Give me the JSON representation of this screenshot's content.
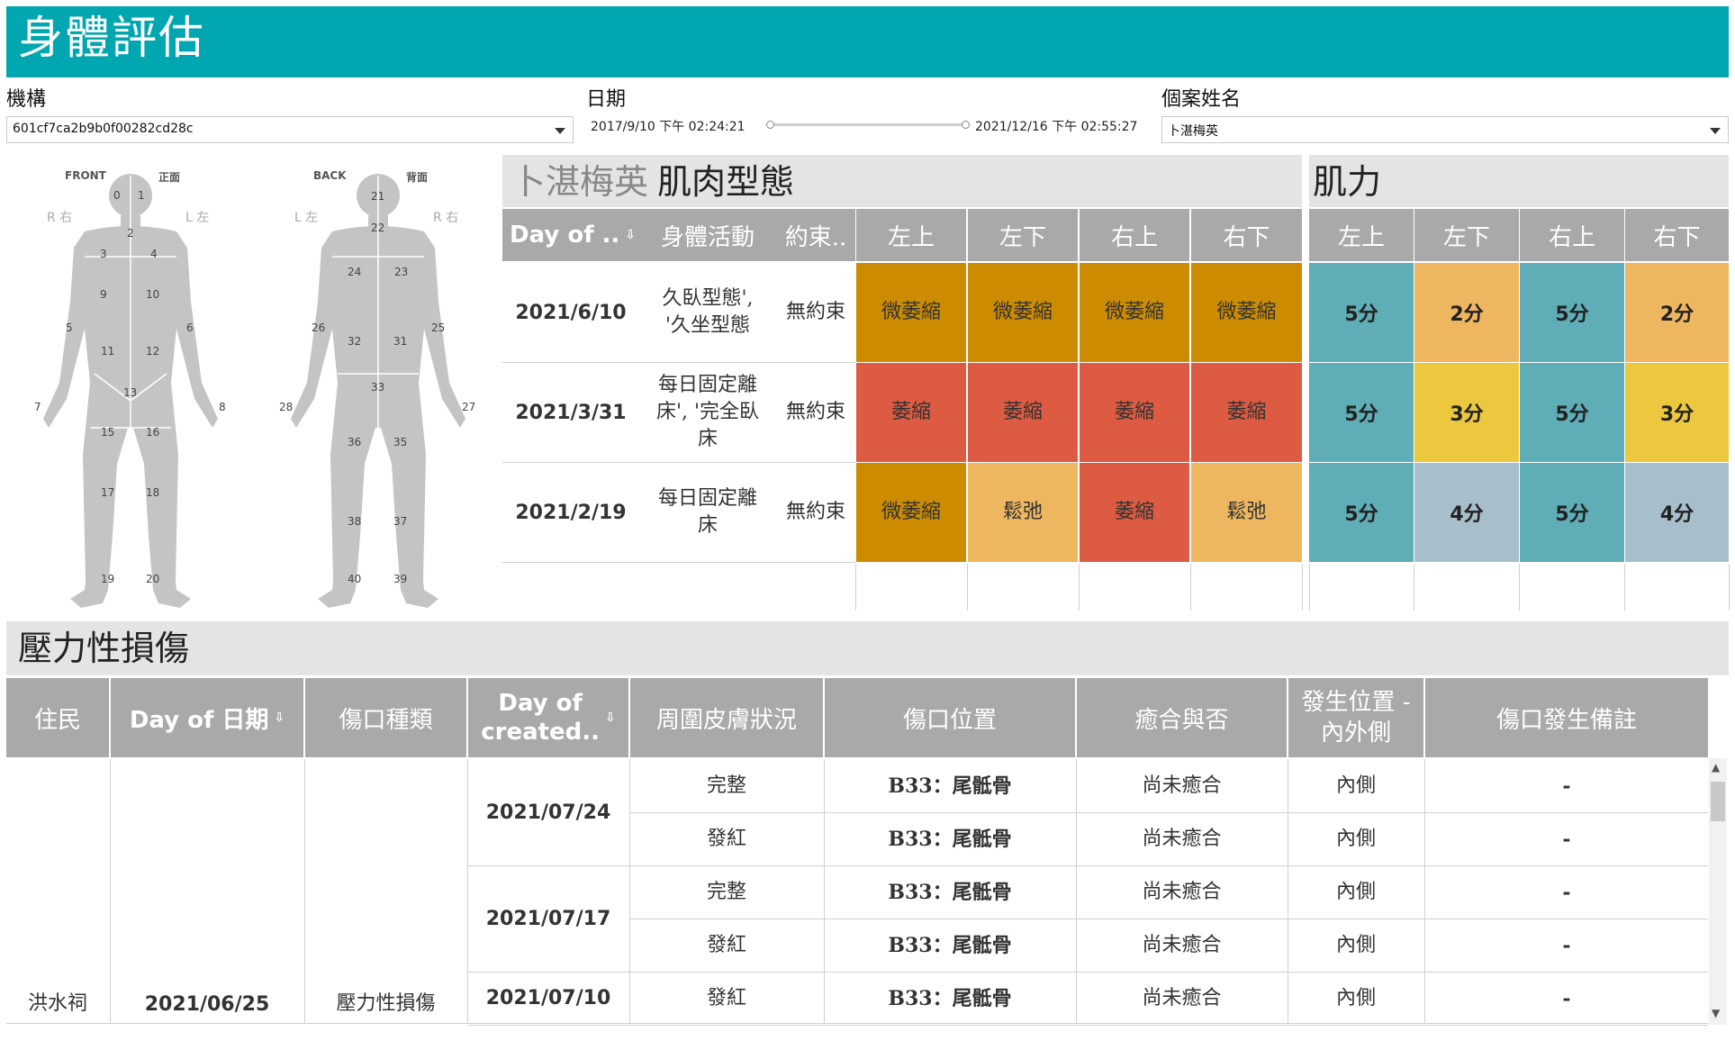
{
  "header": {
    "title": "身體評估"
  },
  "filters": {
    "org": {
      "label": "機構",
      "value": "601cf7ca2b9b0f00282cd28c"
    },
    "date": {
      "label": "日期",
      "start": "2017/9/10 下午 02:24:21",
      "end": "2021/12/16 下午 02:55:27"
    },
    "resident": {
      "label": "個案姓名",
      "value": "卜湛梅英"
    }
  },
  "body_map": {
    "front_en": "FRONT",
    "front_zh": "正面",
    "back_en": "BACK",
    "back_zh": "背面",
    "front_right": "R 右",
    "front_left": "L 左",
    "back_left": "L 左",
    "back_right": "R 右",
    "front_regions": [
      "0",
      "1",
      "2",
      "3",
      "4",
      "9",
      "10",
      "5",
      "6",
      "11",
      "12",
      "13",
      "7",
      "8",
      "15",
      "16",
      "17",
      "18",
      "19",
      "20"
    ],
    "back_regions": [
      "21",
      "22",
      "24",
      "23",
      "26",
      "25",
      "32",
      "31",
      "33",
      "28",
      "27",
      "36",
      "35",
      "38",
      "37",
      "40",
      "39"
    ]
  },
  "muscle": {
    "title_name": "卜湛梅英",
    "title_suffix": "肌肉型態",
    "headers": [
      "Day of ..",
      "身體活動",
      "約束..",
      "左上",
      "左下",
      "右上",
      "右下"
    ],
    "rows": [
      {
        "date": "2021/6/10",
        "activity": "久臥型態',\n'久坐型態",
        "restraint": "無約束",
        "values": [
          "微萎縮",
          "微萎縮",
          "微萎縮",
          "微萎縮"
        ]
      },
      {
        "date": "2021/3/31",
        "activity": "每日固定離\n床', '完全臥\n床",
        "restraint": "無約束",
        "values": [
          "萎縮",
          "萎縮",
          "萎縮",
          "萎縮"
        ]
      },
      {
        "date": "2021/2/19",
        "activity": "每日固定離\n床",
        "restraint": "無約束",
        "values": [
          "微萎縮",
          "鬆弛",
          "萎縮",
          "鬆弛"
        ]
      }
    ],
    "colors": {
      "微萎縮": "#cc8b00",
      "萎縮": "#dc5b42",
      "鬆弛": "#eeb65f"
    }
  },
  "strength": {
    "title": "肌力",
    "headers": [
      "左上",
      "左下",
      "右上",
      "右下"
    ],
    "rows": [
      [
        "5分",
        "2分",
        "5分",
        "2分"
      ],
      [
        "5分",
        "3分",
        "5分",
        "3分"
      ],
      [
        "5分",
        "4分",
        "5分",
        "4分"
      ]
    ],
    "colors": {
      "5分": "#5fadb6",
      "2分": "#eeb65f",
      "3分": "#ecc83e",
      "4分": "#a7bfcb"
    }
  },
  "pressure": {
    "title": "壓力性損傷",
    "headers": [
      "住民",
      "Day of 日期",
      "傷口種類",
      "Day of\ncreated..",
      "周圍皮膚狀況",
      "傷口位置",
      "癒合與否",
      "發生位置 -\n內外側",
      "傷口發生備註"
    ],
    "resident": "洪水祠",
    "date": "2021/06/25",
    "wound_type": "壓力性損傷",
    "created_dates": [
      "2021/07/24",
      "2021/07/17",
      "2021/07/10"
    ],
    "rows": [
      {
        "skin": "完整",
        "location": "B33：尾骶骨",
        "healed": "尚未癒合",
        "side": "內側",
        "note": "-"
      },
      {
        "skin": "發紅",
        "location": "B33：尾骶骨",
        "healed": "尚未癒合",
        "side": "內側",
        "note": "-"
      },
      {
        "skin": "完整",
        "location": "B33：尾骶骨",
        "healed": "尚未癒合",
        "side": "內側",
        "note": "-"
      },
      {
        "skin": "發紅",
        "location": "B33：尾骶骨",
        "healed": "尚未癒合",
        "side": "內側",
        "note": "-"
      },
      {
        "skin": "發紅",
        "location": "B33：尾骶骨",
        "healed": "尚未癒合",
        "side": "內側",
        "note": "-"
      }
    ]
  }
}
